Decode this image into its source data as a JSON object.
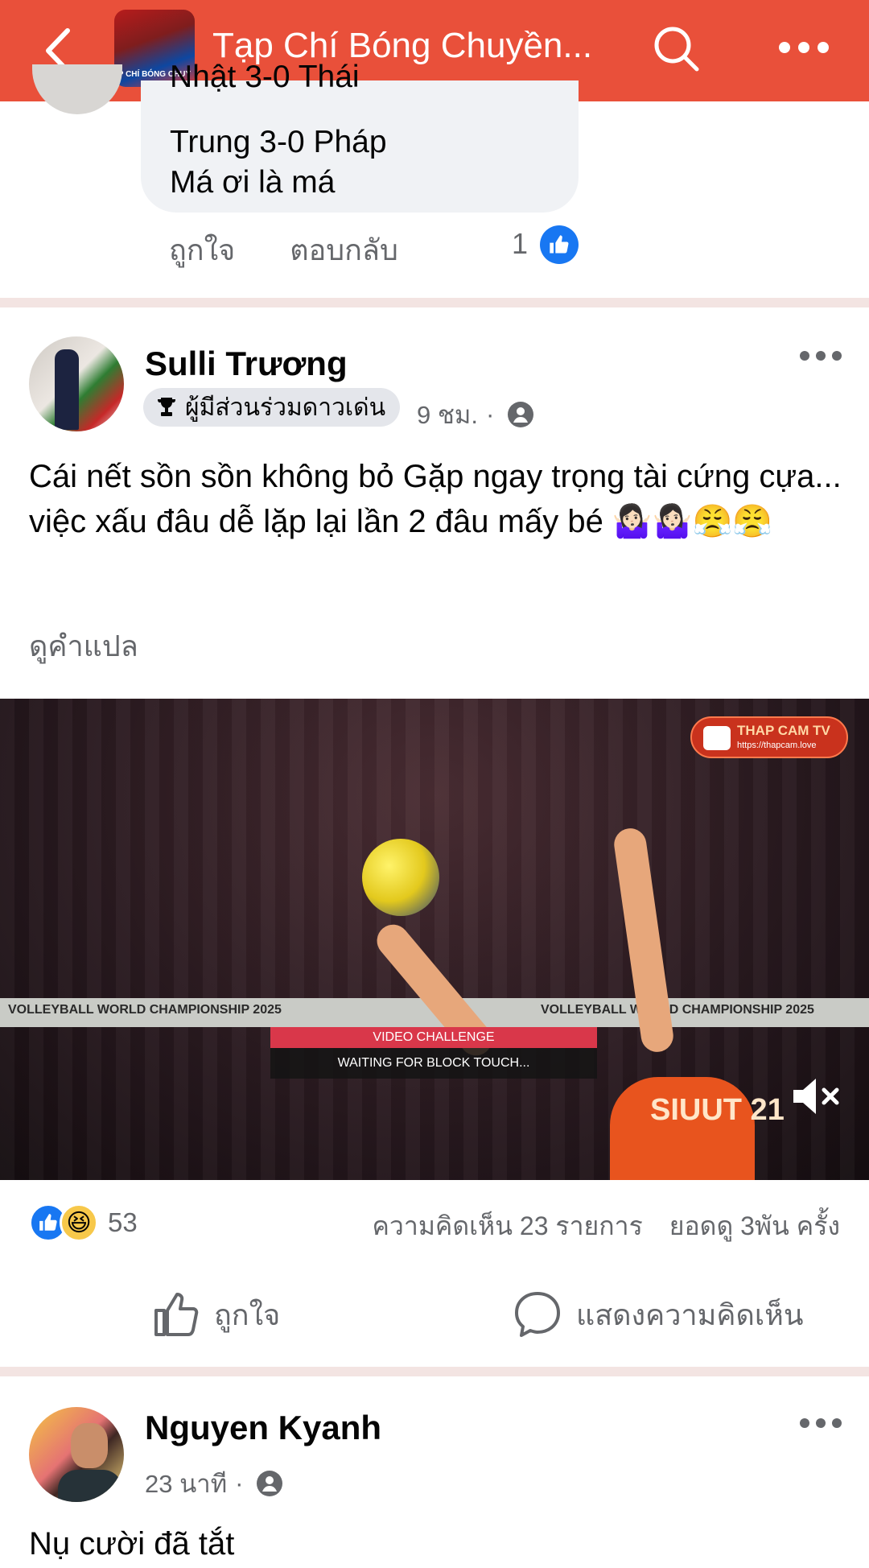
{
  "topbar": {
    "title": "Tạp Chí Bóng Chuyền...",
    "avatar_text": "P CHÍ BÓNG CHUY"
  },
  "previous_comment": {
    "partial_line": "Nhật 3-0 Thái",
    "lines": [
      "Trung 3-0 Pháp",
      "Má ơi là má"
    ],
    "like_label": "ถูกใจ",
    "reply_label": "ตอบกลับ",
    "like_count": "1"
  },
  "post": {
    "author": "Sulli Trương",
    "badge": "ผู้มีส่วนร่วมดาวเด่น",
    "time": "9 ชม.",
    "text": "Cái nết sồn sồn không bỏ Gặp ngay trọng tài cứng cựa... việc xấu đâu dễ lặp lại lần 2 đâu mấy bé 🤷🏻‍♀️🤷🏻‍♀️😤😤",
    "translate_label": "ดูคำแปล",
    "video": {
      "logo_line1": "THAP CAM TV",
      "logo_line2": "https://thapcam.love",
      "net_banner_left": "VOLLEYBALL WORLD CHAMPIONSHIP 2025",
      "net_banner_right": "VOLLEYBALL WORLD CHAMPIONSHIP 2025",
      "jersey": "SIUUT 21",
      "chyron_title": "VIDEO CHALLENGE",
      "chyron_sub": "WAITING FOR BLOCK TOUCH...",
      "muted": true
    },
    "reaction_count": "53",
    "comments": "ความคิดเห็น 23 รายการ",
    "views": "ยอดดู 3พัน ครั้ง",
    "like_action": "ถูกใจ",
    "comment_action": "แสดงความคิดเห็น"
  },
  "next_post": {
    "author": "Nguyen Kyanh",
    "time": "23 นาที",
    "text": "Nụ cười đã tắt"
  },
  "colors": {
    "header": "#e9503a",
    "like_blue": "#1877f2",
    "secondary_text": "#65676b"
  }
}
